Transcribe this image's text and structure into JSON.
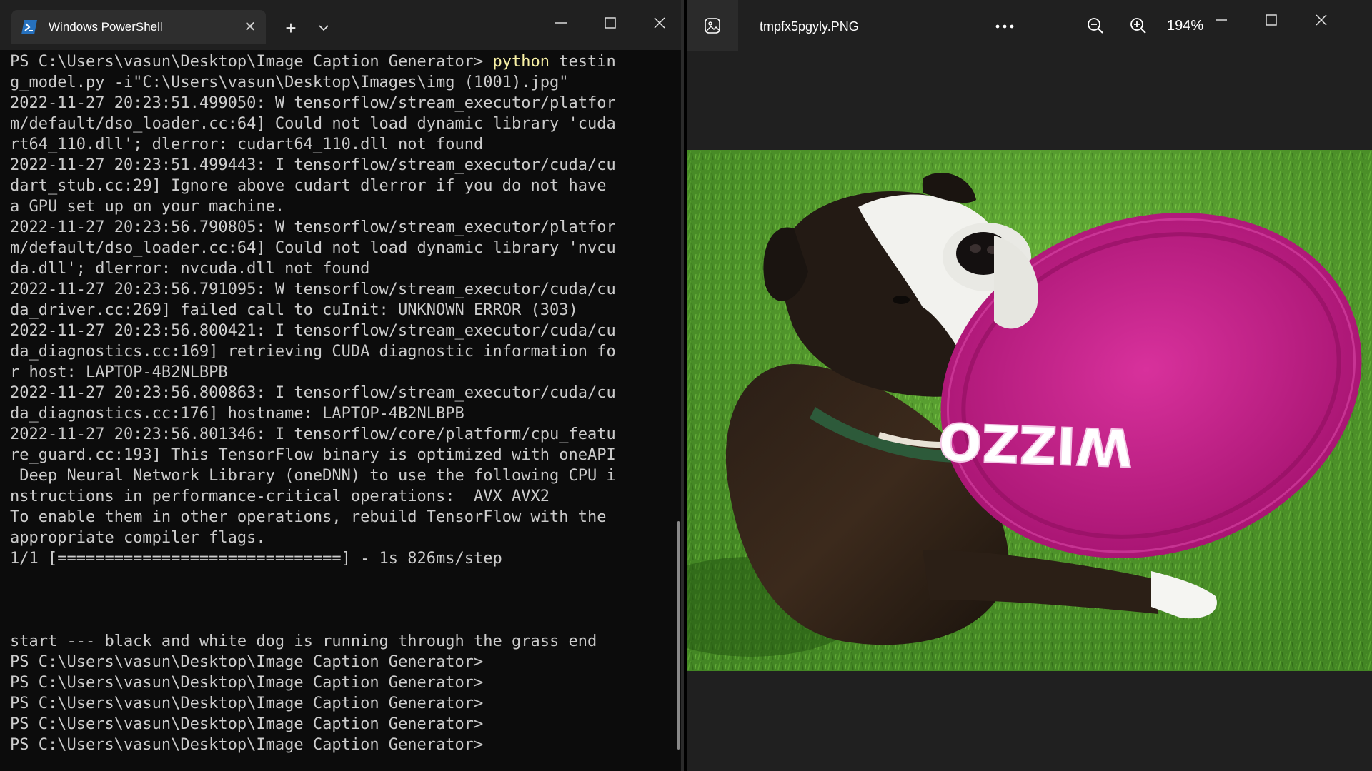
{
  "terminal": {
    "tab_title": "Windows PowerShell",
    "tab_close_glyph": "✕",
    "new_tab_glyph": "+",
    "dropdown_glyph": "⌄",
    "icons": {
      "app": "powershell-icon",
      "close": "close-icon",
      "minimize": "minimize-icon",
      "maximize": "maximize-icon"
    },
    "prompt_prefix": "PS C:\\Users\\vasun\\Desktop\\Image Caption Generator> ",
    "command_word": "python",
    "command_rest": " testin\ng_model.py -i\"C:\\Users\\vasun\\Desktop\\Images\\img (1001).jpg\"",
    "output": "2022-11-27 20:23:51.499050: W tensorflow/stream_executor/platfor\nm/default/dso_loader.cc:64] Could not load dynamic library 'cuda\nrt64_110.dll'; dlerror: cudart64_110.dll not found\n2022-11-27 20:23:51.499443: I tensorflow/stream_executor/cuda/cu\ndart_stub.cc:29] Ignore above cudart dlerror if you do not have\na GPU set up on your machine.\n2022-11-27 20:23:56.790805: W tensorflow/stream_executor/platfor\nm/default/dso_loader.cc:64] Could not load dynamic library 'nvcu\nda.dll'; dlerror: nvcuda.dll not found\n2022-11-27 20:23:56.791095: W tensorflow/stream_executor/cuda/cu\nda_driver.cc:269] failed call to cuInit: UNKNOWN ERROR (303)\n2022-11-27 20:23:56.800421: I tensorflow/stream_executor/cuda/cu\nda_diagnostics.cc:169] retrieving CUDA diagnostic information fo\nr host: LAPTOP-4B2NLBPB\n2022-11-27 20:23:56.800863: I tensorflow/stream_executor/cuda/cu\nda_diagnostics.cc:176] hostname: LAPTOP-4B2NLBPB\n2022-11-27 20:23:56.801346: I tensorflow/core/platform/cpu_featu\nre_guard.cc:193] This TensorFlow binary is optimized with oneAPI\n Deep Neural Network Library (oneDNN) to use the following CPU i\nnstructions in performance-critical operations:  AVX AVX2\nTo enable them in other operations, rebuild TensorFlow with the\nappropriate compiler flags.\n1/1 [==============================] - 1s 826ms/step\n\n\n\nstart --- black and white dog is running through the grass end\nPS C:\\Users\\vasun\\Desktop\\Image Caption Generator>\nPS C:\\Users\\vasun\\Desktop\\Image Caption Generator>\nPS C:\\Users\\vasun\\Desktop\\Image Caption Generator>\nPS C:\\Users\\vasun\\Desktop\\Image Caption Generator>\nPS C:\\Users\\vasun\\Desktop\\Image Caption Generator>",
    "colors": {
      "background": "#0c0c0c",
      "text": "#cccccc",
      "command": "#f9f1a5",
      "titlebar": "#202020"
    }
  },
  "viewer": {
    "filename": "tmpfx5pgyly.PNG",
    "zoom": "194%",
    "more_glyph": "•••",
    "frisbee_text": "WIZZO",
    "icons": {
      "app": "photos-app-icon",
      "more": "more-icon",
      "zoom_out": "zoom-out-icon",
      "zoom_in": "zoom-in-icon",
      "minimize": "minimize-icon",
      "maximize": "maximize-icon",
      "close": "close-icon"
    },
    "photo_subject": "photo-dog-with-frisbee",
    "colors": {
      "background": "#202020",
      "grass": "#4f9a2a",
      "frisbee": "#c6218c"
    }
  }
}
